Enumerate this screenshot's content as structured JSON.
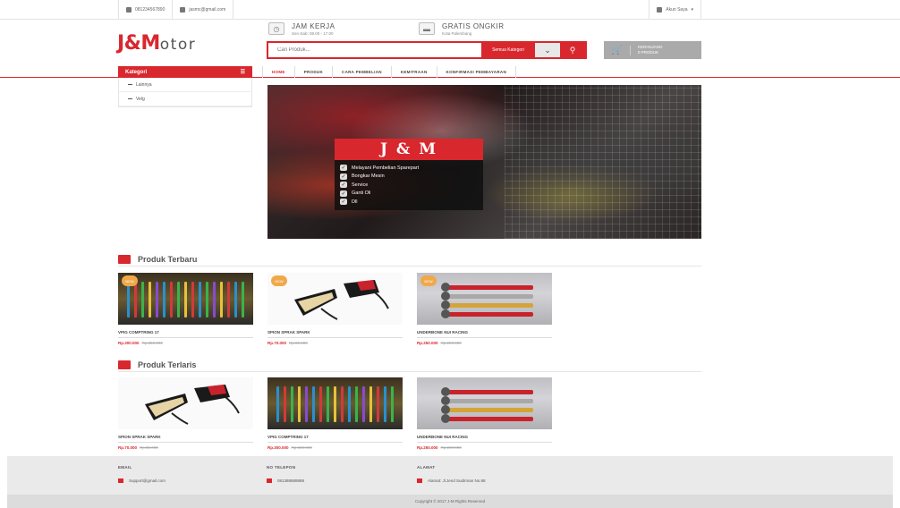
{
  "topbar": {
    "phone": "081234567890",
    "email": "jasmc@gmail.com",
    "account": "Akun Saya"
  },
  "header": {
    "logo_main": "J&M",
    "logo_suffix": "otor",
    "hours_title": "JAM KERJA",
    "hours_sub": "Sen-Sab: 08.00 - 17.00",
    "shipping_title": "GRATIS ONGKIR",
    "shipping_sub": "Kota Palembang",
    "search_placeholder": "Cari Produk...",
    "search_category": "Semua Kategori",
    "cart_line1": "KERANJANG",
    "cart_line2": "0 PRODUK"
  },
  "nav": {
    "kategori_label": "Kategori",
    "menu": [
      "HOME",
      "PRODUK",
      "CARA PEMBELIAN",
      "KEMITRAAN",
      "KONFIRMASI PEMBAYARAN"
    ]
  },
  "sidebar": {
    "items": [
      "Lainnya",
      "Velg"
    ]
  },
  "banner": {
    "title": "J & M",
    "items": [
      "Melayani Pembelian Sparepart",
      "Bongkar Mesin",
      "Service",
      "Ganti Oli",
      "Dll"
    ]
  },
  "section_new": {
    "title": "Produk Terbaru",
    "products": [
      {
        "badge": "NEW",
        "name": "VPIG COMPTRING 17",
        "price": "Rp.300.000",
        "old_price": "Rp.350.000"
      },
      {
        "badge": "NEW",
        "name": "SPION SPRAK SPARK",
        "price": "Rp.70.000",
        "old_price": "Rp.85.000"
      },
      {
        "badge": "NEW",
        "name": "UNDERBONE NUI RACING",
        "price": "Rp.250.000",
        "old_price": "Rp.290.000"
      }
    ]
  },
  "section_best": {
    "title": "Produk Terlaris",
    "products": [
      {
        "name": "SPION SPRAK SPARK",
        "price": "Rp.70.000",
        "old_price": "Rp.85.000"
      },
      {
        "name": "VPIG COMPTRING 17",
        "price": "Rp.300.000",
        "old_price": "Rp.350.000"
      },
      {
        "name": "UNDERBONE NUI RACING",
        "price": "Rp.250.000",
        "old_price": "Rp.290.000"
      }
    ]
  },
  "footer": {
    "email_label": "EMAIL",
    "email_value": "Support@gmail.com",
    "phone_label": "NO TELEPON",
    "phone_value": "081388888888",
    "address_label": "ALAMAT",
    "address_value": "Alamat: Jl.Jend Sudirman No.88",
    "copyright": "Copyright © 2017 J-M Rights Reserved"
  },
  "colors": {
    "accent": "#d9272e",
    "badge": "#f0a94a"
  }
}
